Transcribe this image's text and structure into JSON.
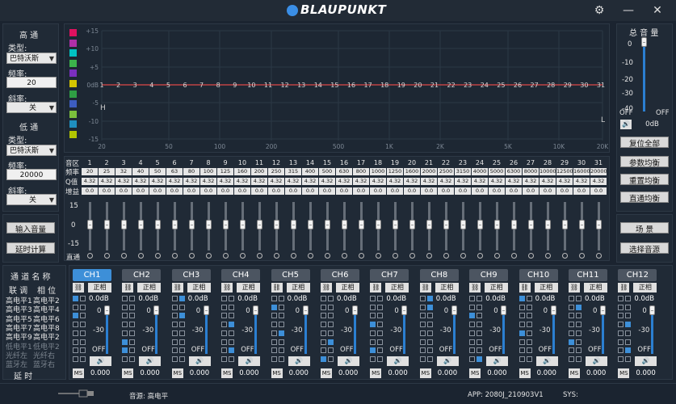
{
  "header": {
    "brand": "BLAUPUNKT",
    "icons": [
      "gear-icon",
      "minimize-icon",
      "close-icon"
    ]
  },
  "left": {
    "high": {
      "title": "高 通",
      "type_label": "类型:",
      "type_value": "巴特沃斯",
      "freq_label": "频率:",
      "freq_value": "20",
      "slope_label": "斜率:",
      "slope_value": "关"
    },
    "low": {
      "title": "低 通",
      "type_label": "类型:",
      "type_value": "巴特沃斯",
      "freq_label": "频率:",
      "freq_value": "20000",
      "slope_label": "斜率:",
      "slope_value": "关"
    },
    "input_volume": "输入音量",
    "delay_calc": "延时计算"
  },
  "graph": {
    "y_labels": [
      "+15",
      "+10",
      "+5",
      "0dB",
      "-5",
      "-10",
      "-15"
    ],
    "x_labels": [
      "20",
      "50",
      "100",
      "200",
      "500",
      "1K",
      "2K",
      "5K",
      "10K",
      "20K"
    ],
    "H": "H",
    "L": "L",
    "point_labels": [
      "1",
      "2",
      "3",
      "4",
      "5",
      "6",
      "7",
      "8",
      "9",
      "10",
      "11",
      "12",
      "13",
      "14",
      "15",
      "16",
      "17",
      "18",
      "19",
      "20",
      "21",
      "22",
      "23",
      "24",
      "25",
      "26",
      "27",
      "28",
      "29",
      "30",
      "31"
    ],
    "swatch_colors": [
      "#e0115f",
      "#b02fa8",
      "#00c3c3",
      "#3cb44b",
      "#7b2fbf",
      "#d4c400",
      "#2f9e44",
      "#3d5dbf",
      "#7bbf3c",
      "#1f8fbf",
      "#b0c400"
    ]
  },
  "eq": {
    "row_labels": [
      "音区",
      "频率",
      "Q值",
      "增益"
    ],
    "bands": [
      "1",
      "2",
      "3",
      "4",
      "5",
      "6",
      "7",
      "8",
      "9",
      "10",
      "11",
      "12",
      "13",
      "14",
      "15",
      "16",
      "17",
      "18",
      "19",
      "20",
      "21",
      "22",
      "23",
      "24",
      "25",
      "26",
      "27",
      "28",
      "29",
      "30",
      "31"
    ],
    "freqs": [
      "20",
      "25",
      "32",
      "40",
      "50",
      "63",
      "80",
      "100",
      "125",
      "160",
      "200",
      "250",
      "315",
      "400",
      "500",
      "630",
      "800",
      "1000",
      "1250",
      "1600",
      "2000",
      "2500",
      "3150",
      "4000",
      "5000",
      "6300",
      "8000",
      "10000",
      "12500",
      "16000",
      "20000"
    ],
    "q": [
      "4.32",
      "4.32",
      "4.32",
      "4.32",
      "4.32",
      "4.32",
      "4.32",
      "4.32",
      "4.32",
      "4.32",
      "4.32",
      "4.32",
      "4.32",
      "4.32",
      "4.32",
      "4.32",
      "4.32",
      "4.32",
      "4.32",
      "4.32",
      "4.32",
      "4.32",
      "4.32",
      "4.32",
      "4.32",
      "4.32",
      "4.32",
      "4.32",
      "4.32",
      "4.32",
      "4.32"
    ],
    "gain": [
      "0.0",
      "0.0",
      "0.0",
      "0.0",
      "0.0",
      "0.0",
      "0.0",
      "0.0",
      "0.0",
      "0.0",
      "0.0",
      "0.0",
      "0.0",
      "0.0",
      "0.0",
      "0.0",
      "0.0",
      "0.0",
      "0.0",
      "0.0",
      "0.0",
      "0.0",
      "0.0",
      "0.0",
      "0.0",
      "0.0",
      "0.0",
      "0.0",
      "0.0",
      "0.0",
      "0.0"
    ],
    "scale_top": "15",
    "scale_mid": "0",
    "scale_bot": "-15",
    "bypass": "直通"
  },
  "right": {
    "master_title": "总 音 量",
    "scale": [
      "0",
      "-10",
      "-20",
      "-30",
      "-40"
    ],
    "off_left": "OFF",
    "off_right": "OFF",
    "master_value": "0dB",
    "buttons": [
      "复位全部",
      "参数均衡",
      "重置均衡",
      "直通均衡"
    ],
    "scene": "场 景",
    "select_sound": "选择音源"
  },
  "channels_left": {
    "title": "通 道 名 称",
    "link": "联 调",
    "phase": "相 位",
    "rows": [
      [
        "高电平1",
        "高电平2"
      ],
      [
        "高电平3",
        "高电平4"
      ],
      [
        "高电平5",
        "高电平6"
      ],
      [
        "高电平7",
        "高电平8"
      ],
      [
        "高电平9",
        "高电平2"
      ],
      [
        "低电平1",
        "低电平2"
      ],
      [
        "光纤左",
        "光纤右"
      ],
      [
        "蓝牙左",
        "蓝牙右"
      ]
    ],
    "delay": "延 时"
  },
  "channels": [
    {
      "name": "CH1",
      "active": true
    },
    {
      "name": "CH2",
      "active": false
    },
    {
      "name": "CH3",
      "active": false
    },
    {
      "name": "CH4",
      "active": false
    },
    {
      "name": "CH5",
      "active": false
    },
    {
      "name": "CH6",
      "active": false
    },
    {
      "name": "CH7",
      "active": false
    },
    {
      "name": "CH8",
      "active": false
    },
    {
      "name": "CH9",
      "active": false
    },
    {
      "name": "CH10",
      "active": false
    },
    {
      "name": "CH11",
      "active": false
    },
    {
      "name": "CH12",
      "active": false
    }
  ],
  "channel_common": {
    "phase": "正相",
    "gain": "0.0dB",
    "top": "0",
    "mid": "-30",
    "off": "OFF",
    "ms": "MS",
    "delay": "0.000"
  },
  "status": {
    "source": "音源: 高电平",
    "app": "APP: 2080J_210903V1",
    "sys": "SYS:"
  }
}
